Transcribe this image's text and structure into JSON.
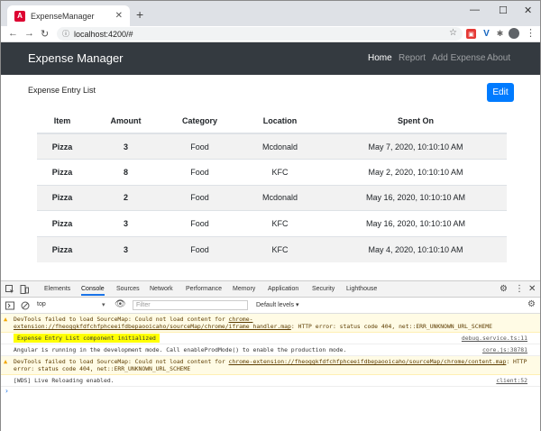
{
  "browser": {
    "tab_title": "ExpenseManager",
    "tab_favicon_letter": "A",
    "url": "localhost:4200/#"
  },
  "navbar": {
    "brand": "Expense Manager",
    "links": [
      "Home",
      "Report",
      "Add Expense",
      "About"
    ]
  },
  "content": {
    "list_title": "Expense Entry List",
    "edit_label": "Edit",
    "columns": [
      "Item",
      "Amount",
      "Category",
      "Location",
      "Spent On"
    ],
    "rows": [
      [
        "Pizza",
        "3",
        "Food",
        "Mcdonald",
        "May 7, 2020, 10:10:10 AM"
      ],
      [
        "Pizza",
        "8",
        "Food",
        "KFC",
        "May 2, 2020, 10:10:10 AM"
      ],
      [
        "Pizza",
        "2",
        "Food",
        "Mcdonald",
        "May 16, 2020, 10:10:10 AM"
      ],
      [
        "Pizza",
        "3",
        "Food",
        "KFC",
        "May 16, 2020, 10:10:10 AM"
      ],
      [
        "Pizza",
        "3",
        "Food",
        "KFC",
        "May 4, 2020, 10:10:10 AM"
      ]
    ]
  },
  "devtools": {
    "tabs": [
      "Elements",
      "Console",
      "Sources",
      "Network",
      "Performance",
      "Memory",
      "Application",
      "Security",
      "Lighthouse"
    ],
    "context": "top",
    "filter_placeholder": "Filter",
    "levels": "Default levels",
    "messages": [
      {
        "type": "warn",
        "text": "DevTools failed to load SourceMap: Could not load content for ",
        "link": "chrome-extension://fheoggkfdfchfphceeifdbepaooicaho/sourceMap/chrome/iframe_handler.map",
        "tail": ": HTTP error: status code 404, net::ERR_UNKNOWN_URL_SCHEME",
        "source": ""
      },
      {
        "type": "log",
        "text": "Expense Entry List component initialized",
        "source": "debug.service.ts:11"
      },
      {
        "type": "log",
        "text": "Angular is running in the development mode. Call enableProdMode() to enable the production mode.",
        "source": "core.js:38781"
      },
      {
        "type": "warn",
        "text": "DevTools failed to load SourceMap: Could not load content for ",
        "link": "chrome-extension://fheoggkfdfchfphceeifdbepaooicaho/sourceMap/chrome/content.map",
        "tail": ": HTTP error: status code 404, net::ERR_UNKNOWN_URL_SCHEME",
        "source": ""
      },
      {
        "type": "log",
        "text": "[WDS] Live Reloading enabled.",
        "source": "client:52"
      }
    ],
    "prompt": "›"
  },
  "colors": {
    "navbar_bg": "#343a40",
    "primary": "#007bff",
    "highlight": "#ffff00"
  }
}
